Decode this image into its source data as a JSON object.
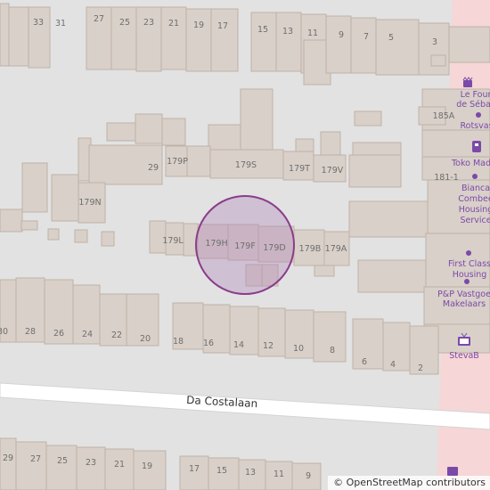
{
  "map": {
    "road_name": "Da Costalaan",
    "attribution_symbol": "©",
    "attribution_text": "OpenStreetMap contributors",
    "colors": {
      "background": "#e2e2e2",
      "building": "#d9d0c9",
      "building_stroke": "#bfb2a8",
      "road": "#ffffff",
      "pedestrian": "#f6d6d6",
      "circle_fill": "#b080b8",
      "circle_stroke": "#8a3d8a",
      "poi_text": "#7b4aa8"
    },
    "house_numbers": {
      "n33": "33",
      "n31": "31",
      "n27": "27",
      "n25": "25",
      "n23": "23",
      "n21": "21",
      "n19": "19",
      "n17": "17",
      "n15": "15",
      "n13": "13",
      "n11": "11",
      "n9": "9",
      "n7": "7",
      "n5": "5",
      "n3": "3",
      "n29a": "29",
      "n179P": "179P",
      "n179S": "179S",
      "n179T": "179T",
      "n179V": "179V",
      "n179N": "179N",
      "n179L": "179L",
      "n179H": "179H",
      "n179F": "179F",
      "n179D": "179D",
      "n179B": "179B",
      "n179A": "179A",
      "n185A": "185A",
      "n181_1": "181-1",
      "s30": "30",
      "s28": "28",
      "s26": "26",
      "s24": "24",
      "s22": "22",
      "s20": "20",
      "s18": "18",
      "s16": "16",
      "s14": "14",
      "s12": "12",
      "s10": "10",
      "s8": "8",
      "s6": "6",
      "s4": "4",
      "s2": "2",
      "b29": "29",
      "b27": "27",
      "b25": "25",
      "b23": "23",
      "b21": "21",
      "b19": "19",
      "b17": "17",
      "b15": "15",
      "b13": "13",
      "b11": "11",
      "b9": "9"
    },
    "pois": {
      "le_four_1": "Le Four",
      "le_four_2": "de Sébas",
      "rotsvast": "Rotsvas",
      "toko": "Toko Mad",
      "bianca_1": "Bianca",
      "bianca_2": "Combee",
      "bianca_3": "Housing",
      "bianca_4": "Service",
      "first_1": "First Class",
      "first_2": "Housing",
      "pp_1": "P&P Vastgoe",
      "pp_2": "Makelaars",
      "steva": "StevaB"
    },
    "icons": {
      "bakery": "bakery-icon",
      "office": "office-dot-icon",
      "shop": "shop-icon",
      "tv": "tv-icon"
    }
  }
}
